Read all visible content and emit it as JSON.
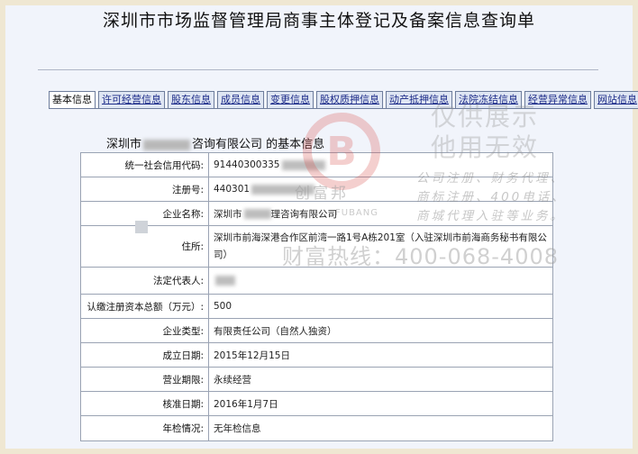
{
  "page": {
    "title": "深圳市市场监督管理局商事主体登记及备案信息查询单"
  },
  "tabs": [
    {
      "label": "基本信息",
      "active": true
    },
    {
      "label": "许可经营信息"
    },
    {
      "label": "股东信息"
    },
    {
      "label": "成员信息"
    },
    {
      "label": "变更信息"
    },
    {
      "label": "股权质押信息"
    },
    {
      "label": "动产抵押信息"
    },
    {
      "label": "法院冻结信息"
    },
    {
      "label": "经营异常信息"
    },
    {
      "label": "网站信息"
    }
  ],
  "section": {
    "prefix": "深圳市",
    "suffix": "咨询有限公司 的基本信息"
  },
  "rows": [
    {
      "key": "统一社会信用代码:",
      "value": "91440300335"
    },
    {
      "key": "注册号:",
      "value": "440301"
    },
    {
      "key": "企业名称:",
      "value": "深圳市",
      "value_suffix": "理咨询有限公司"
    },
    {
      "key": "住所:",
      "value": "深圳市前海深港合作区前湾一路1号A栋201室（入驻深圳市前海商务秘书有限公司）"
    },
    {
      "key": "法定代表人:",
      "value": ""
    },
    {
      "key": "认缴注册资本总额（万元）:",
      "value": "500"
    },
    {
      "key": "企业类型:",
      "value": "有限责任公司（自然人独资）"
    },
    {
      "key": "成立日期:",
      "value": "2015年12月15日"
    },
    {
      "key": "营业期限:",
      "value": "永续经营"
    },
    {
      "key": "核准日期:",
      "value": "2016年1月7日"
    },
    {
      "key": "年检情况:",
      "value": "无年检信息"
    }
  ],
  "watermark": {
    "line1": "仅供展示",
    "line2": "他用无效",
    "services": [
      "公司注册、财务代理、",
      "商标注册、400电话、",
      "商城代理入驻等业务。"
    ],
    "hotline": "财富热线：400-068-4008",
    "brand": "创富邦",
    "brand_en": "FUBANG",
    "logo_letter": "B",
    "color": "#d9534f"
  }
}
